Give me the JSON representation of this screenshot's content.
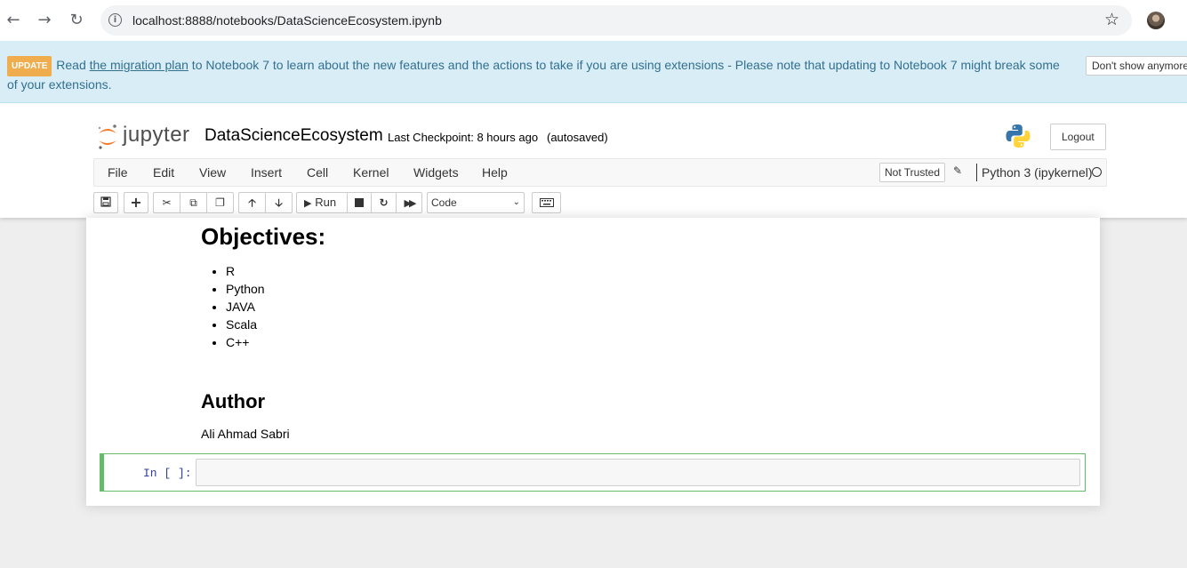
{
  "browser": {
    "url": "localhost:8888/notebooks/DataScienceEcosystem.ipynb"
  },
  "banner": {
    "badge": "UPDATE",
    "text_before": " Read ",
    "link": "the migration plan",
    "text_after": " to Notebook 7 to learn about the new features and the actions to take if you are using extensions - Please note that updating to Notebook 7 might break some of your extensions.",
    "dismiss_label": "Don't show anymore"
  },
  "header": {
    "logo_text": "jupyter",
    "notebook_name": "DataScienceEcosystem",
    "checkpoint": "Last Checkpoint: 8 hours ago",
    "autosave": "(autosaved)",
    "logout_label": "Logout"
  },
  "menubar": {
    "items": [
      "File",
      "Edit",
      "View",
      "Insert",
      "Cell",
      "Kernel",
      "Widgets",
      "Help"
    ],
    "trust_label": "Not Trusted",
    "kernel_name": "Python 3 (ipykernel)"
  },
  "toolbar": {
    "run_label": "Run",
    "cell_type": "Code"
  },
  "notebook": {
    "objectives_heading": "Objectives:",
    "objectives": [
      "R",
      "Python",
      "JAVA",
      "Scala",
      "C++"
    ],
    "author_heading": "Author",
    "author_name": "Ali Ahmad Sabri",
    "code_prompt": "In [ ]:"
  }
}
